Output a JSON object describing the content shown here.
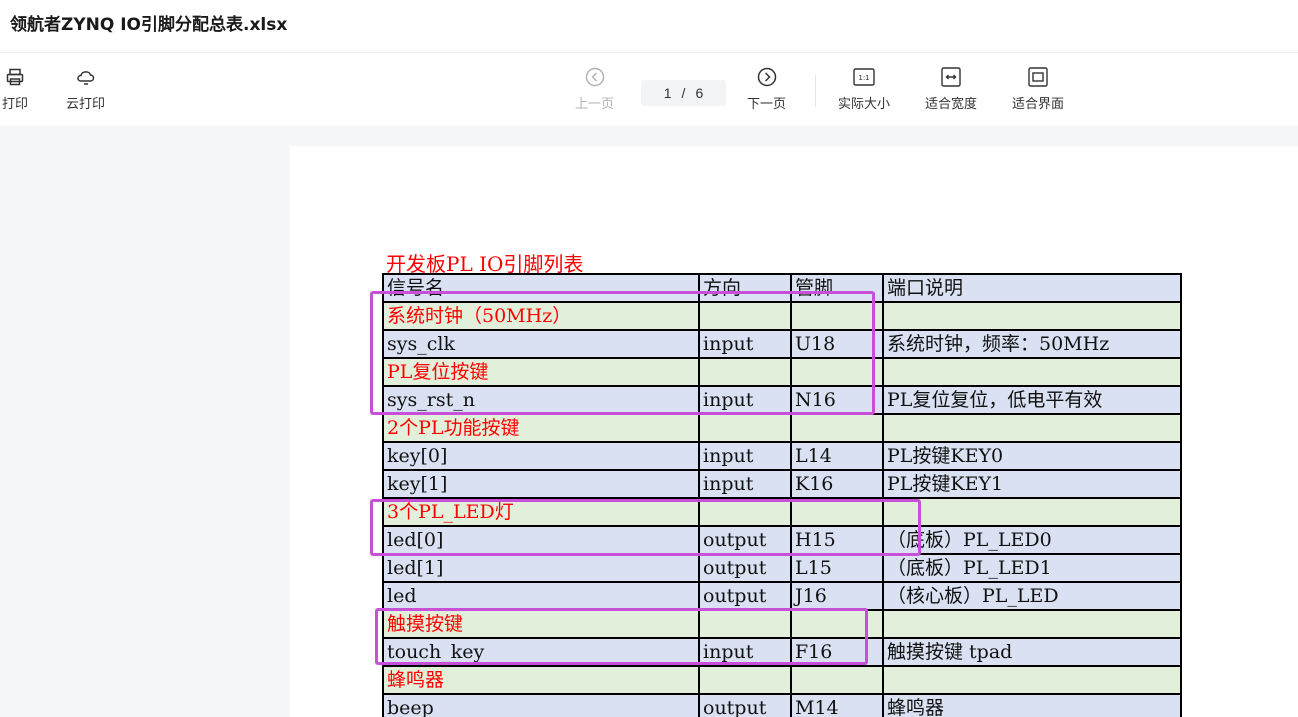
{
  "window": {
    "title": "领航者ZYNQ IO引脚分配总表.xlsx"
  },
  "toolbar": {
    "print": "打印",
    "cloud_print": "云打印",
    "prev_page": "上一页",
    "next_page": "下一页",
    "actual_size": "实际大小",
    "fit_width": "适合宽度",
    "fit_screen": "适合界面",
    "page_current": "1",
    "page_sep": "/",
    "page_total": "6"
  },
  "sheet": {
    "title": "开发板PL IO引脚列表",
    "header": [
      "信号名",
      "方向",
      "管脚",
      "端口说明"
    ],
    "rows": [
      {
        "kind": "category",
        "cells": [
          "系统时钟（50MHz）",
          "",
          "",
          ""
        ]
      },
      {
        "kind": "signal",
        "cells": [
          "sys_clk",
          "input",
          "U18",
          "系统时钟，频率：50MHz"
        ]
      },
      {
        "kind": "category",
        "cells": [
          "PL复位按键",
          "",
          "",
          ""
        ]
      },
      {
        "kind": "signal",
        "cells": [
          "sys_rst_n",
          "input",
          "N16",
          "PL复位复位，低电平有效"
        ]
      },
      {
        "kind": "category",
        "cells": [
          "2个PL功能按键",
          "",
          "",
          ""
        ]
      },
      {
        "kind": "signal",
        "cells": [
          "key[0]",
          "input",
          "L14",
          "PL按键KEY0"
        ]
      },
      {
        "kind": "signal",
        "cells": [
          "key[1]",
          "input",
          "K16",
          "PL按键KEY1"
        ]
      },
      {
        "kind": "category",
        "cells": [
          "3个PL_LED灯",
          "",
          "",
          ""
        ]
      },
      {
        "kind": "signal",
        "cells": [
          "led[0]",
          "output",
          "H15",
          "（底板）PL_LED0"
        ]
      },
      {
        "kind": "signal",
        "cells": [
          "led[1]",
          "output",
          "L15",
          "（底板）PL_LED1"
        ]
      },
      {
        "kind": "signal",
        "cells": [
          "led",
          "output",
          "J16",
          "（核心板）PL_LED"
        ]
      },
      {
        "kind": "category",
        "cells": [
          "触摸按键",
          "",
          "",
          ""
        ]
      },
      {
        "kind": "signal",
        "cells": [
          "touch_key",
          "input",
          "F16",
          "触摸按键 tpad"
        ]
      },
      {
        "kind": "category",
        "cells": [
          "蜂鸣器",
          "",
          "",
          ""
        ]
      },
      {
        "kind": "signal",
        "cells": [
          "beep",
          "output",
          "M14",
          "蜂鸣器"
        ]
      }
    ]
  },
  "colors": {
    "header_fill": "#d9e1f2",
    "category_fill": "#e2efda",
    "category_text": "#ff0000",
    "highlight": "#c850d8"
  }
}
